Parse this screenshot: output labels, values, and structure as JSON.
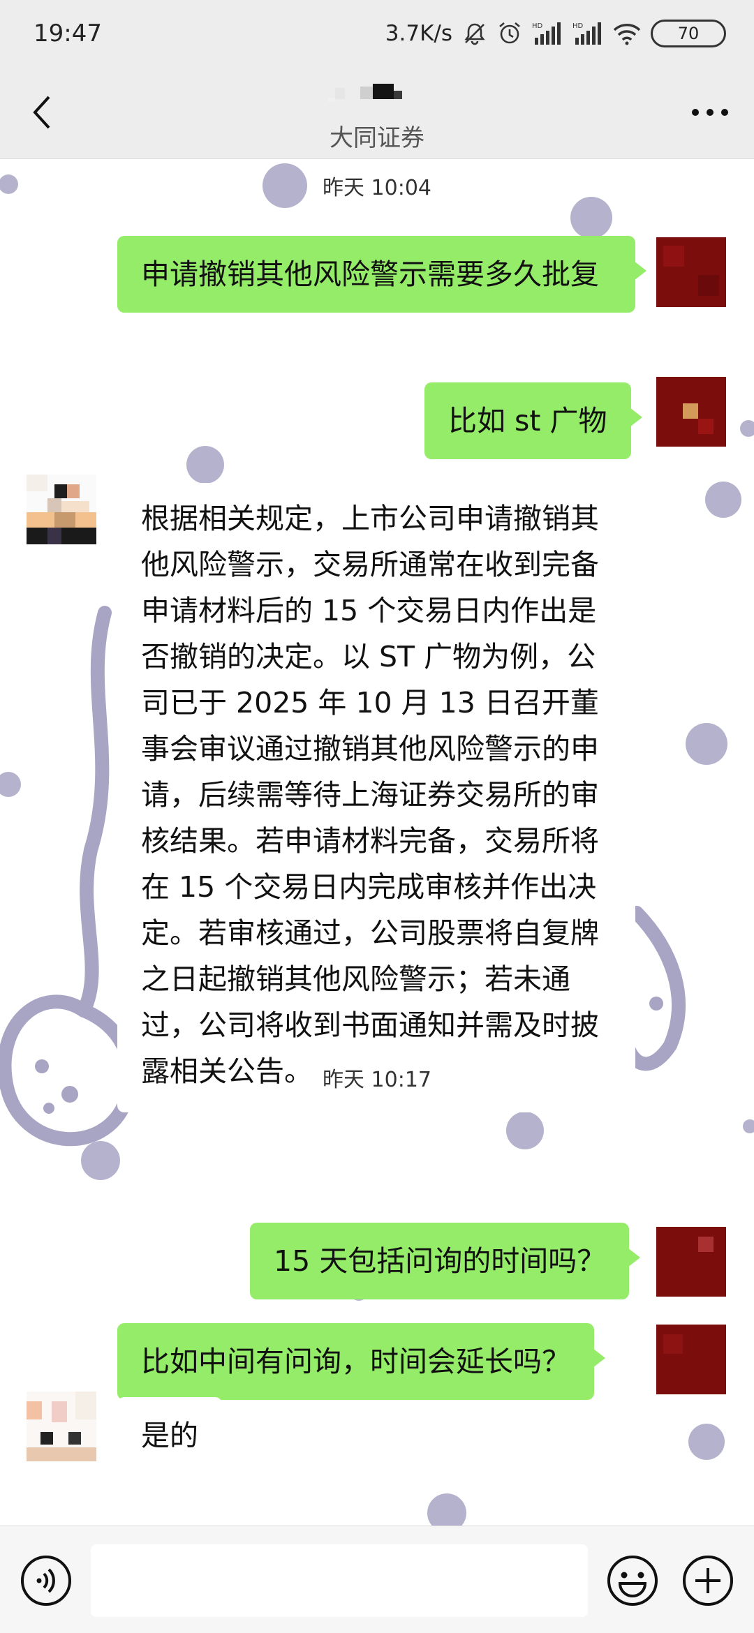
{
  "status_bar": {
    "time": "19:47",
    "network_speed": "3.7K/s",
    "icons": [
      "mute-bell-icon",
      "alarm-icon",
      "hd-signal-icon",
      "hd-signal-icon",
      "wifi-icon"
    ],
    "battery": "70"
  },
  "header": {
    "back_icon": "chevron-left-icon",
    "contact_subtitle": "大同证券",
    "more_icon": "more-dots-icon"
  },
  "messages": [
    {
      "type": "time",
      "text": "昨天 10:04"
    },
    {
      "type": "sent",
      "text": "申请撤销其他风险警示需要多久批复"
    },
    {
      "type": "sent",
      "text": "比如 st 广物"
    },
    {
      "type": "received",
      "text": "根据相关规定，上市公司申请撤销其他风险警示，交易所通常在收到完备申请材料后的 15 个交易日内作出是否撤销的决定。以 ST 广物为例，公司已于 2025 年 10 月 13 日召开董事会审议通过撤销其他风险警示的申请，后续需等待上海证券交易所的审核结果。若申请材料完备，交易所将在 15 个交易日内完成审核并作出决定。若审核通过，公司股票将自复牌之日起撤销其他风险警示；若未通过，公司将收到书面通知并需及时披露相关公告。"
    },
    {
      "type": "time",
      "text": "昨天 10:17"
    },
    {
      "type": "sent",
      "text": "15 天包括问询的时间吗？"
    },
    {
      "type": "sent",
      "text": "比如中间有问询，时间会延长吗？"
    },
    {
      "type": "received",
      "text": "是的"
    }
  ],
  "input_bar": {
    "voice_icon": "voice-icon",
    "input_value": "",
    "emoji_icon": "emoji-icon",
    "plus_icon": "plus-icon"
  },
  "colors": {
    "sent_bubble": "#95ec69",
    "received_bubble": "#ffffff",
    "header_bg": "#ededed",
    "self_avatar": "#7c0d0d",
    "wallpaper_motif": "#a8a4c4"
  }
}
